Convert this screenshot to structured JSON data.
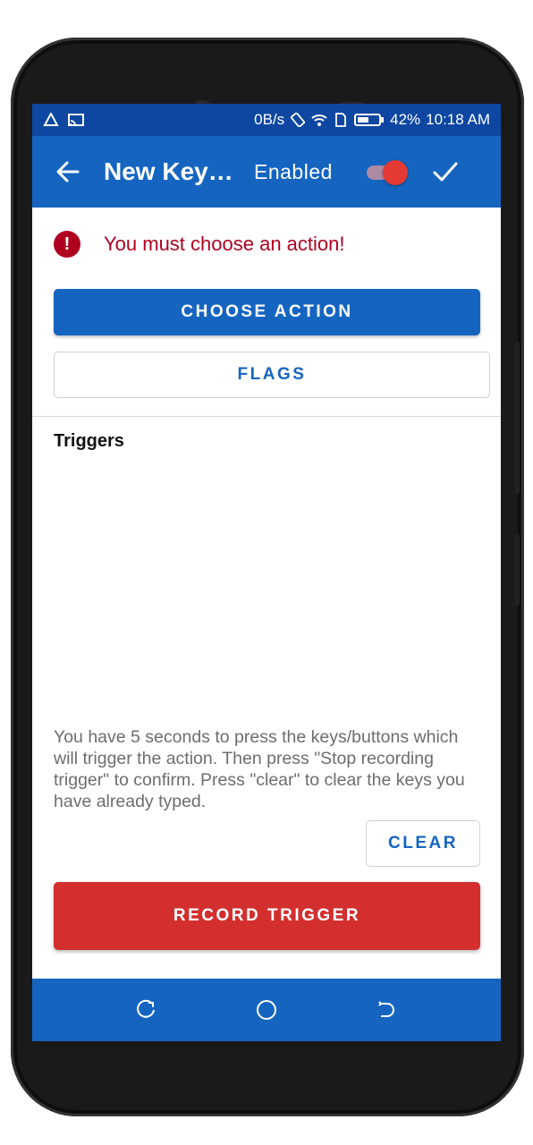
{
  "status_bar": {
    "net_speed": "0B/s",
    "battery": "42%",
    "time": "10:18 AM"
  },
  "app_bar": {
    "title": "New Key…",
    "enabled_label": "Enabled",
    "toggle_on": true
  },
  "error": {
    "message": "You must choose an action!"
  },
  "buttons": {
    "choose_action": "CHOOSE ACTION",
    "flags": "FLAGS",
    "clear": "CLEAR",
    "record_trigger": "RECORD TRIGGER"
  },
  "triggers": {
    "title": "Triggers",
    "help": "You have 5 seconds to press the keys/buttons which will trigger the action. Then press \"Stop recording trigger\" to confirm. Press \"clear\" to clear the keys you have already typed."
  },
  "icons": {
    "back": "arrow-back-icon",
    "check": "check-icon",
    "error": "error-icon",
    "nav_recent": "recent-apps-icon",
    "nav_home": "home-icon",
    "nav_back": "back-icon"
  },
  "colors": {
    "primary": "#1565c0",
    "status_bar": "#0d47a1",
    "error": "#b00020",
    "record": "#d32f2f",
    "toggle": "#e53935"
  }
}
